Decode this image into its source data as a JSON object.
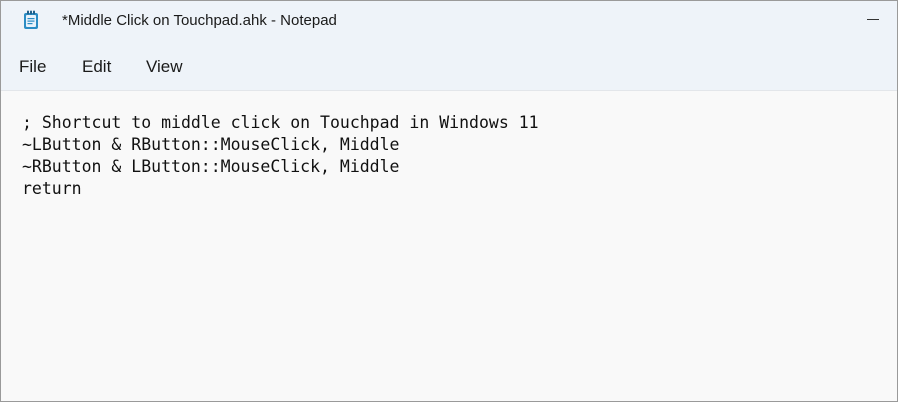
{
  "window": {
    "title": "*Middle Click on Touchpad.ahk - Notepad",
    "icon": "notepad-icon"
  },
  "menu": {
    "file": "File",
    "edit": "Edit",
    "view": "View"
  },
  "editor": {
    "lines": [
      "; Shortcut to middle click on Touchpad in Windows 11",
      "~LButton & RButton::MouseClick, Middle",
      "~RButton & LButton::MouseClick, Middle",
      "return"
    ]
  },
  "colors": {
    "chrome_background": "#eef3f9",
    "editor_background": "#f9f9f9",
    "icon_accent": "#2b8cc4"
  }
}
